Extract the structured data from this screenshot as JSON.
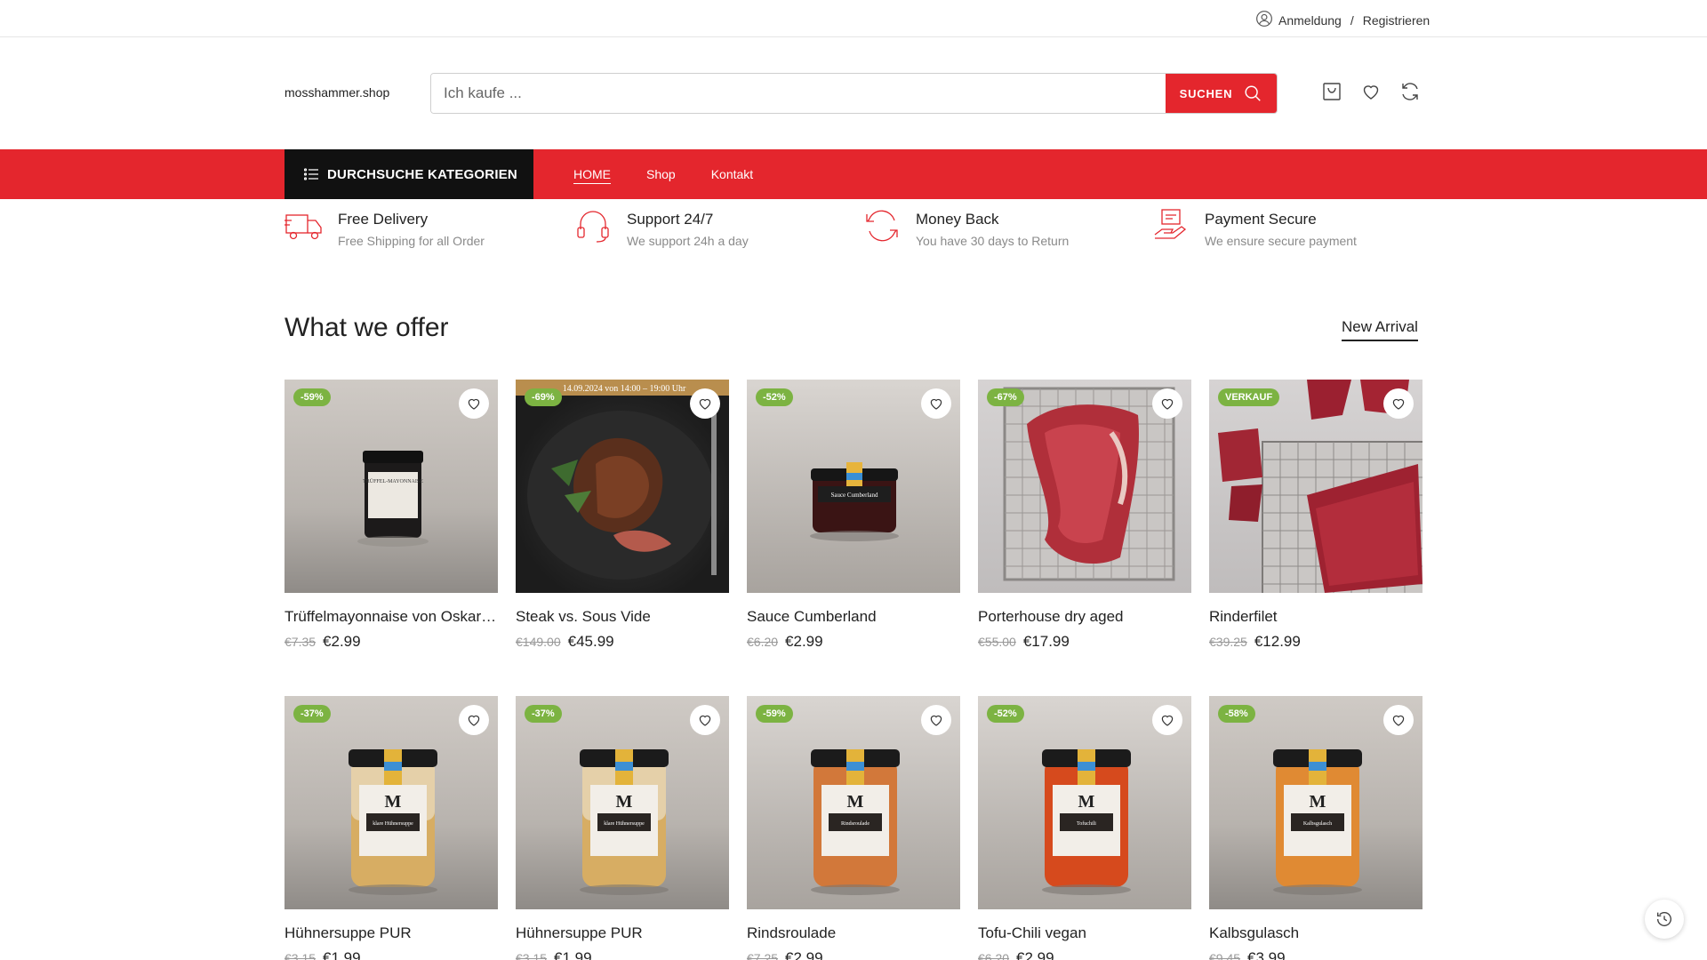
{
  "topbar": {
    "login": "Anmeldung",
    "separator": "/",
    "register": "Registrieren"
  },
  "header": {
    "logo": "mosshammer.shop",
    "search_placeholder": "Ich kaufe ...",
    "search_button": "SUCHEN",
    "icons": [
      "cart-icon",
      "heart-icon",
      "compare-icon"
    ]
  },
  "nav": {
    "categories_button": "DURCHSUCHE KATEGORIEN",
    "links": [
      "HOME",
      "Shop",
      "Kontakt"
    ]
  },
  "features": [
    {
      "title": "Free Delivery",
      "subtitle": "Free Shipping for all Order",
      "icon": "truck-icon"
    },
    {
      "title": "Support 24/7",
      "subtitle": "We support 24h a day",
      "icon": "headset-icon"
    },
    {
      "title": "Money Back",
      "subtitle": "You have 30 days to Return",
      "icon": "refresh-icon"
    },
    {
      "title": "Payment Secure",
      "subtitle": "We ensure secure payment",
      "icon": "payment-icon"
    }
  ],
  "section": {
    "title": "What we offer",
    "link": "New Arrival"
  },
  "products": [
    {
      "badge": "-59%",
      "name": "Trüffelmayonnaise von Oskar am Wasser",
      "old_price": "€7.35",
      "price": "€2.99",
      "image_text": "TRÜFFEL-MAYONNAISE"
    },
    {
      "badge": "-69%",
      "name": "Steak vs. Sous Vide",
      "old_price": "€149.00",
      "price": "€45.99",
      "image_text": "14.09.2024 von 14:00 – 19:00 Uhr"
    },
    {
      "badge": "-52%",
      "name": "Sauce Cumberland",
      "old_price": "€6.20",
      "price": "€2.99",
      "image_text": "Sauce Cumberland"
    },
    {
      "badge": "-67%",
      "name": "Porterhouse dry aged",
      "old_price": "€55.00",
      "price": "€17.99"
    },
    {
      "badge": "VERKAUF",
      "name": "Rinderfilet",
      "old_price": "€39.25",
      "price": "€12.99"
    },
    {
      "badge": "-37%",
      "name": "Hühnersuppe PUR",
      "old_price": "€3.15",
      "price": "€1.99",
      "image_text": "klare Hühnersuppe"
    },
    {
      "badge": "-37%",
      "name": "Hühnersuppe PUR",
      "old_price": "€3.15",
      "price": "€1.99",
      "image_text": "klare Hühnersuppe"
    },
    {
      "badge": "-59%",
      "name": "Rindsroulade",
      "old_price": "€7.25",
      "price": "€2.99",
      "image_text": "Rindsroulade"
    },
    {
      "badge": "-52%",
      "name": "Tofu-Chili vegan",
      "old_price": "€6.20",
      "price": "€2.99",
      "image_text": "Tofuchili"
    },
    {
      "badge": "-58%",
      "name": "Kalbsgulasch",
      "old_price": "€9.45",
      "price": "€3.99",
      "image_text": "Kalbsgulasch"
    }
  ],
  "colors": {
    "accent": "#e4262d",
    "badge": "#7cb342",
    "category_button": "#111111"
  }
}
